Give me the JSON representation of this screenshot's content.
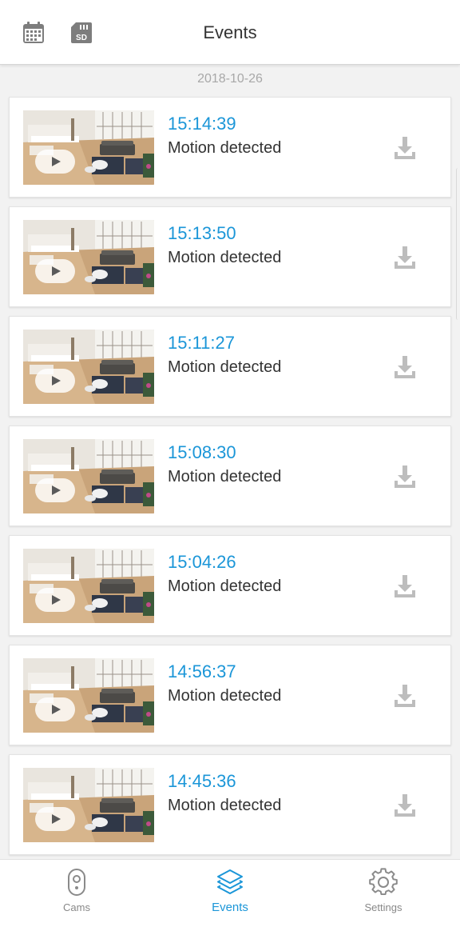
{
  "header": {
    "title": "Events",
    "calendar_icon": "calendar-icon",
    "sd_icon": "sd-card-icon",
    "sd_label": "SD"
  },
  "date_group": "2018-10-26",
  "events": [
    {
      "time": "15:14:39",
      "description": "Motion detected"
    },
    {
      "time": "15:13:50",
      "description": "Motion detected"
    },
    {
      "time": "15:11:27",
      "description": "Motion detected"
    },
    {
      "time": "15:08:30",
      "description": "Motion detected"
    },
    {
      "time": "15:04:26",
      "description": "Motion detected"
    },
    {
      "time": "14:56:37",
      "description": "Motion detected"
    },
    {
      "time": "14:45:36",
      "description": "Motion detected"
    }
  ],
  "tabs": [
    {
      "label": "Cams",
      "icon": "camera-icon",
      "active": false
    },
    {
      "label": "Events",
      "icon": "layers-icon",
      "active": true
    },
    {
      "label": "Settings",
      "icon": "gear-icon",
      "active": false
    }
  ],
  "colors": {
    "accent": "#1b96d8",
    "text": "#333333",
    "muted": "#a8a8a8",
    "background": "#f2f2f2"
  }
}
